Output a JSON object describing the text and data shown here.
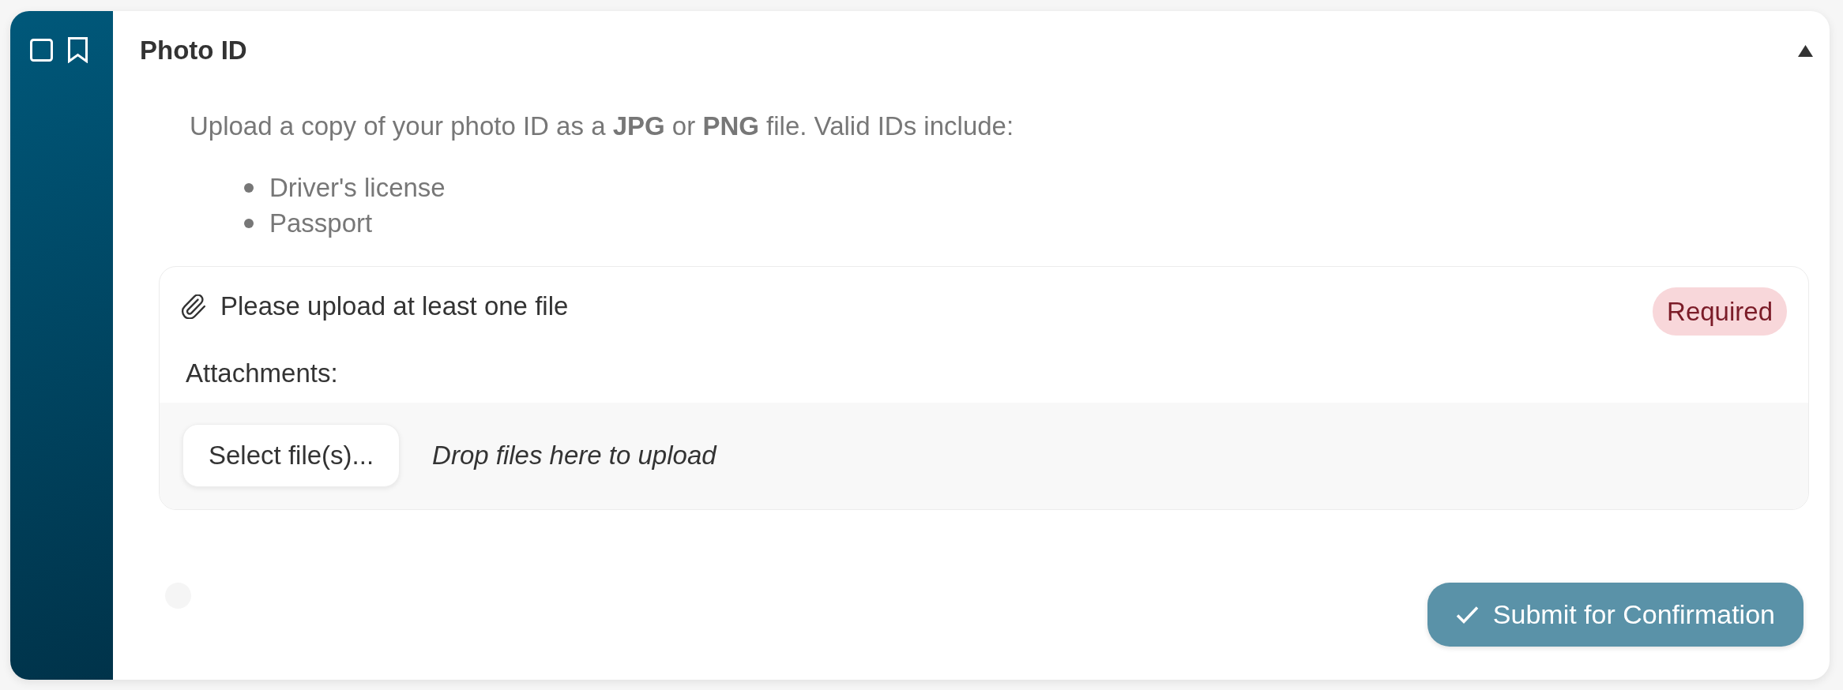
{
  "section": {
    "title": "Photo ID",
    "expanded": true,
    "description": "Upload a copy of your photo ID as a **JPG** or **PNG** file. Valid IDs include:",
    "valid_ids": [
      "Driver's license",
      "Passport"
    ]
  },
  "upload": {
    "prompt": "Please upload at least one file",
    "badge": "Required",
    "label": "Attachments:",
    "select_button": "Select file(s)...",
    "drop_hint": "Drop files here to upload"
  },
  "submit_button": {
    "label": "Submit for Confirmation",
    "disabled": true
  }
}
